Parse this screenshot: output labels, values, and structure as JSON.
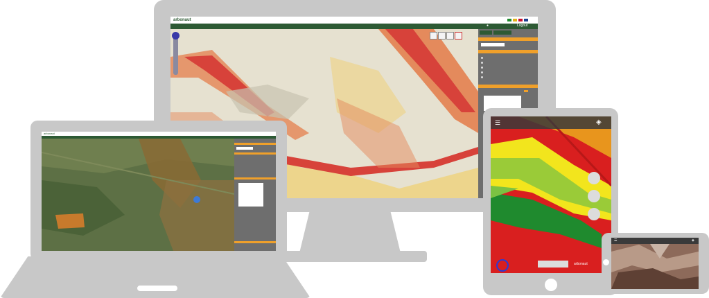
{
  "desktop": {
    "brand": "arbonaut",
    "login_label": "Logout",
    "map_colors": [
      "#e9e4d4",
      "#e48a5c",
      "#d7423a",
      "#c8c3b0",
      "#efd27a"
    ]
  },
  "laptop": {
    "brand": "arbonaut"
  },
  "tablet": {
    "menu_icon": "hamburger-icon",
    "layers_icon": "layers-icon",
    "footer_brand": "arbonaut",
    "map_colors": [
      "#d91f1f",
      "#f2e51d",
      "#7cc242",
      "#1f8a2e"
    ]
  },
  "phone": {
    "header_text": ""
  },
  "colors": {
    "device_gray": "#c8c8c8",
    "app_green": "#2d5a34",
    "panel_gray": "#6e6e6e",
    "accent_orange": "#f0a02a"
  }
}
